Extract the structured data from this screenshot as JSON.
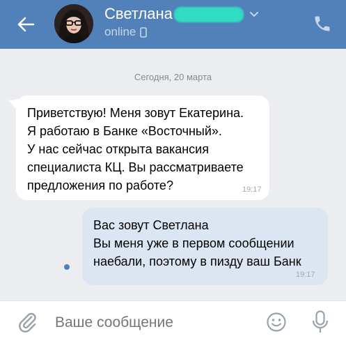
{
  "header": {
    "contact_name": "Светлана",
    "status": "online",
    "back_icon": "arrow-left-icon",
    "call_icon": "phone-icon"
  },
  "date_separator": "Сегодня, 20 марта",
  "messages": [
    {
      "direction": "incoming",
      "text": "Приветствую! Меня зовут Екатерина.\nЯ работаю в Банке «Восточный».\nУ нас сейчас открыта вакансия\nспециалиста КЦ. Вы рассматриваете\nпредложения по работе?",
      "time": "19:17"
    },
    {
      "direction": "outgoing",
      "text": "Вас зовут Светлана\nВы меня уже в первом сообщении\nнаебали, поэтому в пизду ваш Банк",
      "time": "19:17",
      "unread": true
    }
  ],
  "composer": {
    "placeholder": "Ваше сообщение",
    "attach_icon": "paperclip-icon",
    "emoji_icon": "smile-icon",
    "mic_icon": "microphone-icon"
  },
  "colors": {
    "header_bg": "#5181b8",
    "chat_bg": "#ebedf0",
    "incoming_bubble": "#ffffff",
    "outgoing_bubble": "#dce6f3",
    "name_redaction": "#2fe3c6"
  }
}
